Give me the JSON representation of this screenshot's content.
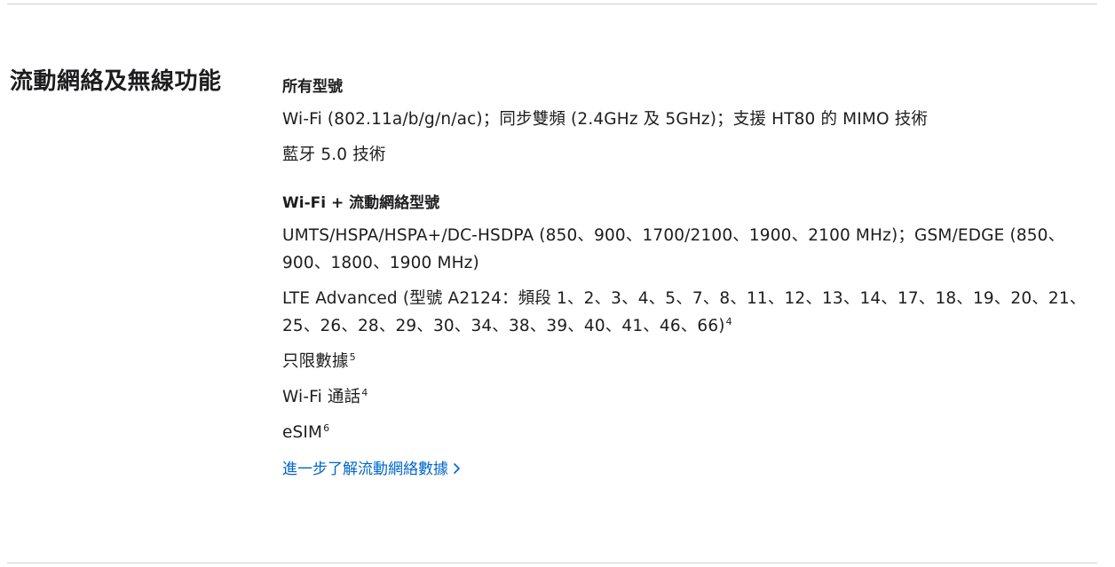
{
  "section": {
    "title": "流動網絡及無線功能"
  },
  "all_models": {
    "title": "所有型號",
    "wifi": "Wi-Fi (802.11a/b/g/n/ac)；同步雙頻 (2.4GHz 及 5GHz)；支援 HT80 的 MIMO 技術",
    "bluetooth": "藍牙 5.0 技術"
  },
  "cellular_models": {
    "title": "Wi-Fi + 流動網絡型號",
    "umts": "UMTS/HSPA/HSPA+/DC-HSDPA (850、900、1700/2100、1900、2100 MHz)；GSM/EDGE (850、900、1800、1900 MHz)",
    "lte": "LTE Advanced (型號 A2124：頻段 1、2、3、4、5、7、8、11、12、13、14、17、18、19、20、21、25、26、28、29、30、34、38、39、40、41、46、66)",
    "lte_footnote": "4",
    "data_only": "只限數據",
    "data_only_footnote": "5",
    "wifi_calling": "Wi-Fi 通話",
    "wifi_calling_footnote": "4",
    "esim": "eSIM",
    "esim_footnote": "6"
  },
  "learn_more": {
    "label": "進一步了解流動網絡數據",
    "icon": "chevron-right-icon",
    "color": "#0066cc"
  }
}
